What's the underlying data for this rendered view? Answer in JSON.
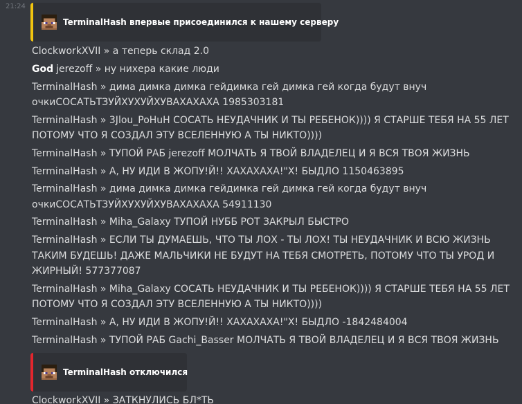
{
  "timestamp": "21:24",
  "colors": {
    "background": "#36393f",
    "embed_background": "#2f3136",
    "join_accent": "#f1c40f",
    "leave_accent": "#e3262d"
  },
  "embeds": {
    "join": {
      "icon": "player-head-icon",
      "text": "TerminalHash впервые присоединился к нашему серверу"
    },
    "leave": {
      "icon": "player-head-icon",
      "text": "TerminalHash отключился"
    }
  },
  "messages": [
    {
      "prefix": "",
      "text": "ClockworkXVII » а теперь склад 2.0"
    },
    {
      "prefix": "God",
      "text": "jerezoff » ну нихера какие люди"
    },
    {
      "prefix": "",
      "text": "TerminalHash » дима димка димка гейдимка гей димка гей когда будут внуч очкиСОСАТЬТЗУЙХУХУЙХУВАХАХАХА 1985303181",
      "lines": 2
    },
    {
      "prefix": "",
      "text": "TerminalHash » 3Jlou_PoHuH СОСАТЬ НЕУДАЧНИК И ТЫ РЕБЕНОК)))) Я СТАРШЕ ТЕБЯ НА 55 ЛЕТ ПОТОМУ ЧТО Я СОЗДАЛ ЭТУ ВСЕЛЕННУЮ А ТЫ НИКТО))))",
      "lines": 2
    },
    {
      "prefix": "",
      "text": "TerminalHash » ТУПОЙ РАБ jerezoff МОЛЧАТЬ Я ТВОЙ ВЛАДЕЛЕЦ И Я ВСЯ ТВОЯ ЖИЗНЬ"
    },
    {
      "prefix": "",
      "text": "TerminalHash » А, НУ ИДИ В ЖОПУ!Й!! ХАХАХАХА!\"Х! БЫДЛО 1150463895"
    },
    {
      "prefix": "",
      "text": "TerminalHash » дима димка димка гейдимка гей димка гей когда будут внуч очкиСОСАТЬТЗУЙХУХУЙХУВАХАХАХА 54911130",
      "lines": 2
    },
    {
      "prefix": "",
      "text": "TerminalHash » Miha_Galaxy ТУПОЙ НУББ РОТ ЗАКРЫЛ БЫСТРО"
    },
    {
      "prefix": "",
      "text": "TerminalHash » ЕСЛИ ТЫ ДУМАЕШЬ, ЧТО ТЫ ЛОХ - ТЫ ЛОХ! ТЫ НЕУДАЧНИК И ВСЮ ЖИЗНЬ ТАКИМ БУДЕШЬ! ДАЖЕ МАЛЬЧИКИ НЕ БУДУТ НА ТЕБЯ СМОТРЕТЬ, ПОТОМУ ЧТО ТЫ УРОД И ЖИРНЫЙ! 577377087",
      "lines": 3
    },
    {
      "prefix": "",
      "text": "TerminalHash » Miha_Galaxy СОСАТЬ НЕУДАЧНИК И ТЫ РЕБЕНОК)))) Я СТАРШЕ ТЕБЯ НА 55 ЛЕТ ПОТОМУ ЧТО Я СОЗДАЛ ЭТУ ВСЕЛЕННУЮ А ТЫ НИКТО))))",
      "lines": 2
    },
    {
      "prefix": "",
      "text": "TerminalHash » А, НУ ИДИ В ЖОПУ!Й!! ХАХАХАХА!\"Х! БЫДЛО -1842484004"
    },
    {
      "prefix": "",
      "text": "TerminalHash » ТУПОЙ РАБ Gachi_Basser МОЛЧАТЬ Я ТВОЙ ВЛАДЕЛЕЦ И Я ВСЯ ТВОЯ ЖИЗНЬ"
    }
  ],
  "last_message": "ClockworkXVII » ЗАТКНУЛИСЬ БЛ*ТЬ"
}
